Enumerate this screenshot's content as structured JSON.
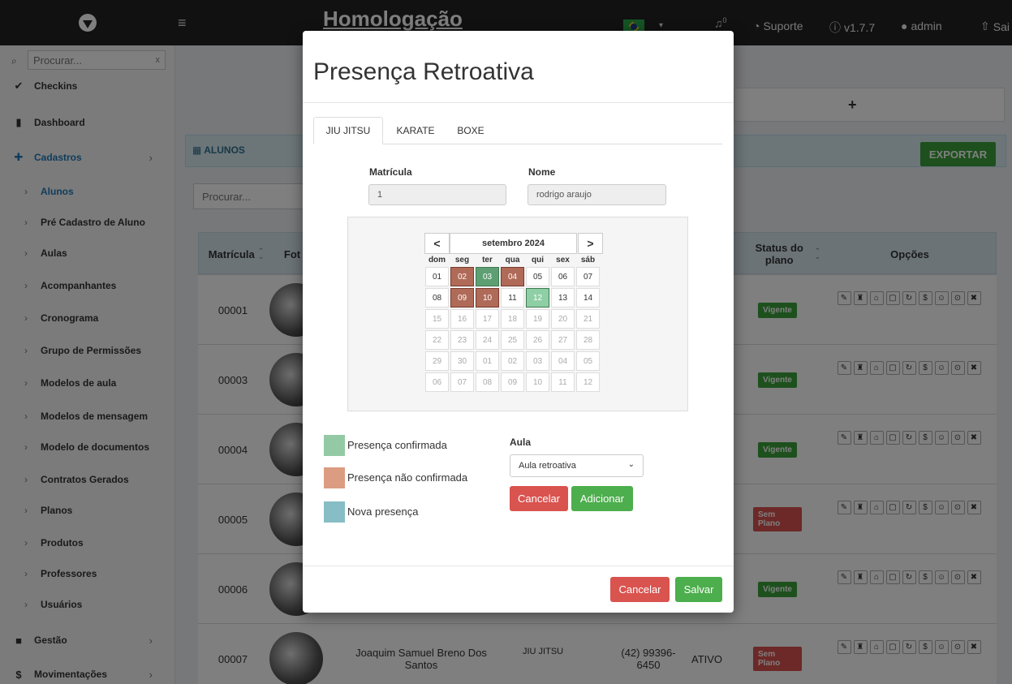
{
  "topbar": {
    "env_title": "Homologação",
    "bell_count": "0",
    "support_label": "Suporte",
    "version_label": "v1.7.7",
    "user_label": "admin",
    "exit_label": "Sai"
  },
  "sidebar": {
    "search_placeholder": "Procurar...",
    "search_clear": "x",
    "items": [
      {
        "label": "Checkins",
        "icon": "check-icon"
      },
      {
        "label": "Dashboard",
        "icon": "bar-chart-icon"
      },
      {
        "label": "Cadastros",
        "icon": "plus-icon"
      },
      {
        "label": "Alunos"
      },
      {
        "label": "Pré Cadastro de Aluno"
      },
      {
        "label": "Aulas"
      },
      {
        "label": "Acompanhantes"
      },
      {
        "label": "Cronograma"
      },
      {
        "label": "Grupo de Permissões"
      },
      {
        "label": "Modelos de aula"
      },
      {
        "label": "Modelos de mensagem"
      },
      {
        "label": "Modelo de documentos"
      },
      {
        "label": "Contratos Gerados"
      },
      {
        "label": "Planos"
      },
      {
        "label": "Produtos"
      },
      {
        "label": "Professores"
      },
      {
        "label": "Usuários"
      },
      {
        "label": "Gestão",
        "icon": "briefcase-icon"
      },
      {
        "label": "Movimentações",
        "icon": "dollar-icon"
      }
    ]
  },
  "main": {
    "panel_title": "ALUNOS",
    "export_label": "EXPORTAR",
    "search_placeholder": "Procurar...",
    "plus_label": "+",
    "columns": {
      "matricula": "Matrícula",
      "foto": "Fot",
      "status": "Status do plano",
      "opcoes": "Opções"
    },
    "rows": [
      {
        "matricula": "00001",
        "status": "Vigente",
        "status_color": "#3aa13a"
      },
      {
        "matricula": "00003",
        "status": "Vigente",
        "status_color": "#3aa13a"
      },
      {
        "matricula": "00004",
        "status": "Vigente",
        "status_color": "#3aa13a"
      },
      {
        "matricula": "00005",
        "status": "Sem Plano",
        "status_color": "#d9534f"
      },
      {
        "matricula": "00006",
        "status": "Vigente",
        "status_color": "#3aa13a"
      },
      {
        "matricula": "00007",
        "name": "Joaquim Samuel Breno Dos Santos",
        "modalidade": "JIU JITSU",
        "phone": "(42) 99396-6450",
        "situacao": "ATIVO",
        "status": "Sem Plano",
        "status_color": "#d9534f"
      }
    ]
  },
  "modal": {
    "title": "Presença Retroativa",
    "tabs": [
      "JIU JITSU",
      "KARATE",
      "BOXE"
    ],
    "matricula_label": "Matrícula",
    "matricula_value": "1",
    "nome_label": "Nome",
    "nome_value": "rodrigo araujo",
    "calendar": {
      "month": "setembro 2024",
      "prev": "<",
      "next": ">",
      "weekdays": [
        "dom",
        "seg",
        "ter",
        "qua",
        "qui",
        "sex",
        "sáb"
      ],
      "weeks": [
        [
          "01",
          "02",
          "03",
          "04",
          "05",
          "06",
          "07"
        ],
        [
          "08",
          "09",
          "10",
          "11",
          "12",
          "13",
          "14"
        ],
        [
          "15",
          "16",
          "17",
          "18",
          "19",
          "20",
          "21"
        ],
        [
          "22",
          "23",
          "24",
          "25",
          "26",
          "27",
          "28"
        ],
        [
          "29",
          "30",
          "01",
          "02",
          "03",
          "04",
          "05"
        ],
        [
          "06",
          "07",
          "08",
          "09",
          "10",
          "11",
          "12"
        ]
      ]
    },
    "legend": [
      {
        "label": "Presença confirmada",
        "color": "#94c9a5"
      },
      {
        "label": "Presença não confirmada",
        "color": "#dc9c82"
      },
      {
        "label": "Nova presença",
        "color": "#87bdc4"
      }
    ],
    "aula_label": "Aula",
    "aula_value": "Aula retroativa",
    "cancel_label": "Cancelar",
    "add_label": "Adicionar",
    "footer_cancel": "Cancelar",
    "footer_save": "Salvar"
  }
}
